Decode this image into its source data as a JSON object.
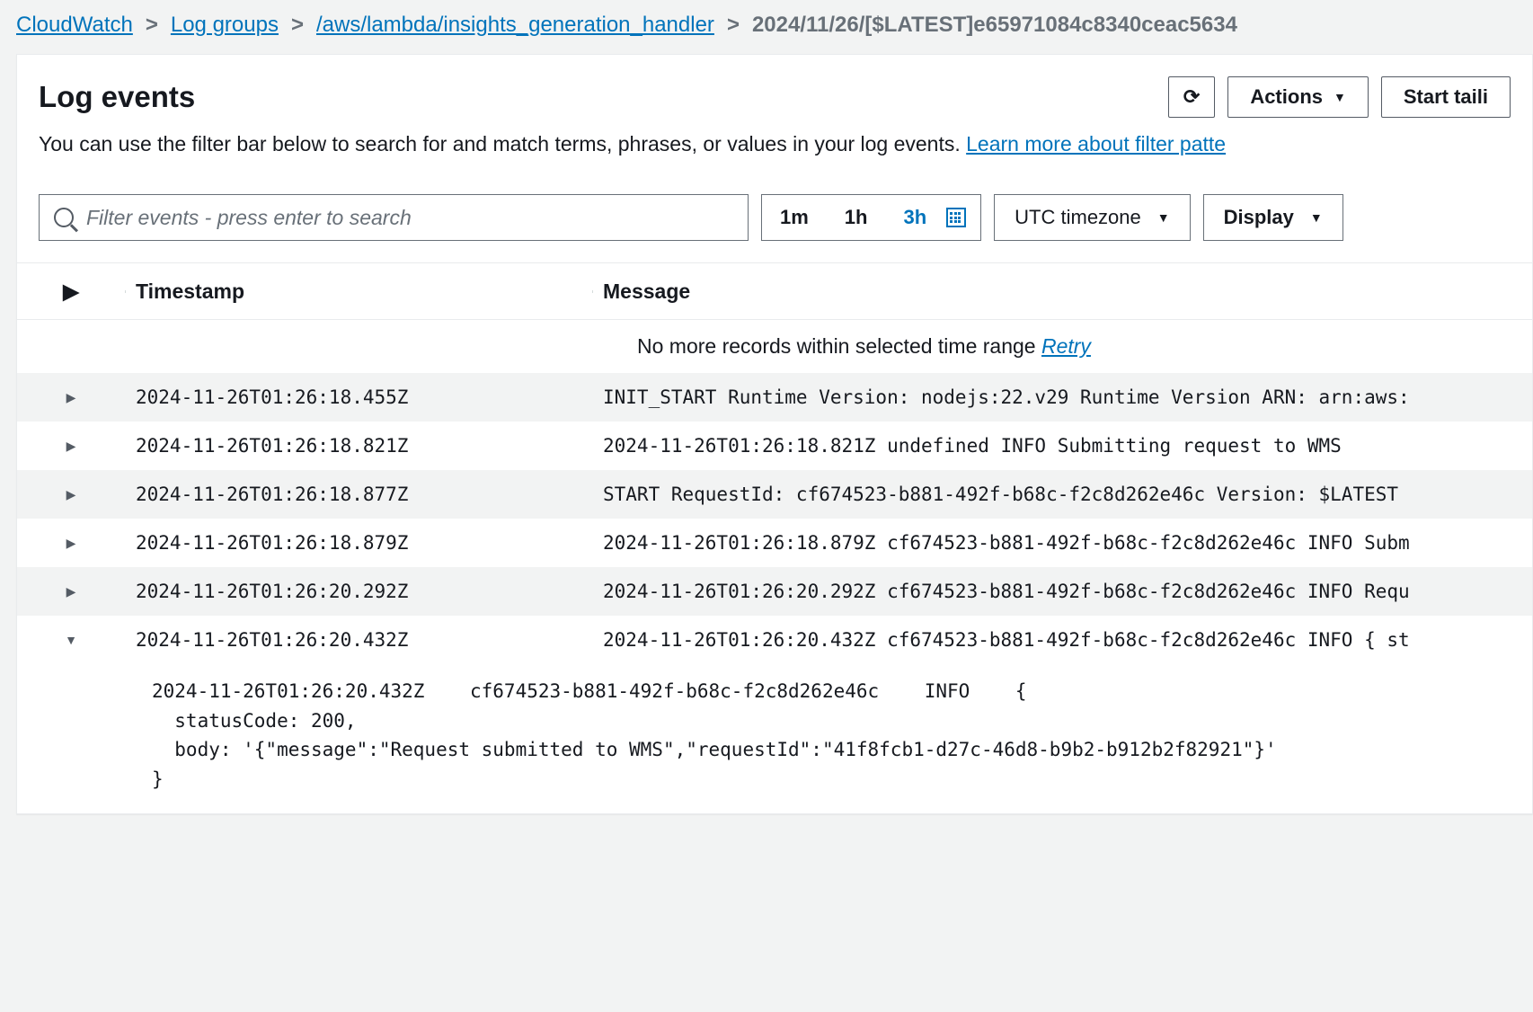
{
  "breadcrumb": {
    "items": [
      {
        "label": "CloudWatch"
      },
      {
        "label": "Log groups"
      },
      {
        "label": "/aws/lambda/insights_generation_handler"
      }
    ],
    "current": "2024/11/26/[$LATEST]e65971084c8340ceac5634"
  },
  "header": {
    "title": "Log events",
    "description_prefix": "You can use the filter bar below to search for and match terms, phrases, or values in your log events. ",
    "learn_more_label": "Learn more about filter patte"
  },
  "buttons": {
    "actions": "Actions",
    "start_tailing": "Start taili"
  },
  "filter": {
    "placeholder": "Filter events - press enter to search",
    "time_options": [
      "1m",
      "1h",
      "3h"
    ],
    "active_time_index": 2,
    "timezone_label": "UTC timezone",
    "display_label": "Display"
  },
  "columns": {
    "timestamp": "Timestamp",
    "message": "Message"
  },
  "no_more": {
    "text": "No more records within selected time range ",
    "retry": "Retry"
  },
  "rows": [
    {
      "expanded": false,
      "timestamp": "2024-11-26T01:26:18.455Z",
      "message": "INIT_START Runtime Version: nodejs:22.v29 Runtime Version ARN: arn:aws:"
    },
    {
      "expanded": false,
      "timestamp": "2024-11-26T01:26:18.821Z",
      "message": "2024-11-26T01:26:18.821Z undefined INFO Submitting request to WMS"
    },
    {
      "expanded": false,
      "timestamp": "2024-11-26T01:26:18.877Z",
      "message": "START RequestId: cf674523-b881-492f-b68c-f2c8d262e46c Version: $LATEST"
    },
    {
      "expanded": false,
      "timestamp": "2024-11-26T01:26:18.879Z",
      "message": "2024-11-26T01:26:18.879Z cf674523-b881-492f-b68c-f2c8d262e46c INFO Subm"
    },
    {
      "expanded": false,
      "timestamp": "2024-11-26T01:26:20.292Z",
      "message": "2024-11-26T01:26:20.292Z cf674523-b881-492f-b68c-f2c8d262e46c INFO Requ"
    },
    {
      "expanded": true,
      "timestamp": "2024-11-26T01:26:20.432Z",
      "message": "2024-11-26T01:26:20.432Z cf674523-b881-492f-b68c-f2c8d262e46c INFO { st"
    }
  ],
  "expanded_body": "2024-11-26T01:26:20.432Z    cf674523-b881-492f-b68c-f2c8d262e46c    INFO    {\n  statusCode: 200,\n  body: '{\"message\":\"Request submitted to WMS\",\"requestId\":\"41f8fcb1-d27c-46d8-b9b2-b912b2f82921\"}'\n}"
}
